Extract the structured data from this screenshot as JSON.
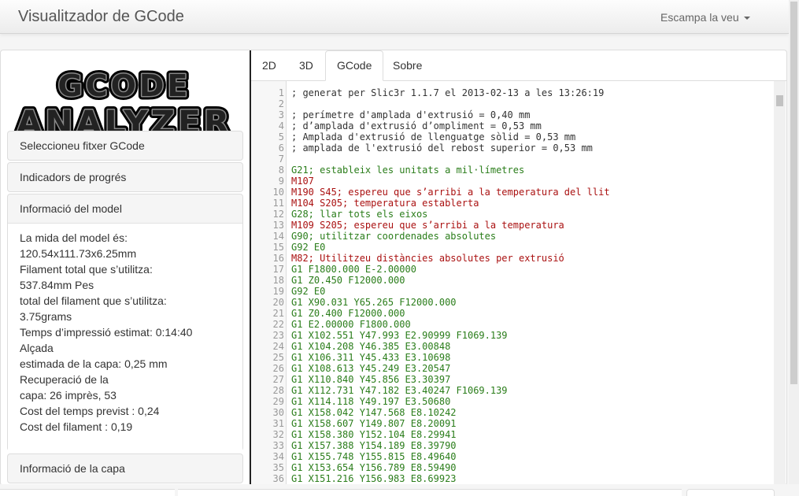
{
  "navbar": {
    "brand": "Visualitzador de GCode",
    "language_menu": "Escampa la veu"
  },
  "logo": {
    "line1": "GCODE",
    "line2": "ANALYZER"
  },
  "sidebar": {
    "sections": [
      {
        "title": "Seleccioneu fitxer GCode"
      },
      {
        "title": "Indicadors de progrés"
      },
      {
        "title": "Informació del model",
        "lines": [
          "La mida del model és:",
          "120.54x111.73x6.25mm",
          "Filament total que s’utilitza:",
          "537.84mm Pes",
          "total del filament que s’utilitza:",
          "3.75grams",
          "Temps d’impressió estimat: 0:14:40",
          "Alçada",
          "estimada de la capa: 0,25 mm",
          "Recuperació de la",
          "capa: 26 imprès, 53",
          "Cost del temps previst : 0,24",
          "Cost del filament : 0,19"
        ]
      },
      {
        "title": "Informació de la capa"
      }
    ]
  },
  "tabs": [
    {
      "label": "2D",
      "active": false
    },
    {
      "label": "3D",
      "active": false
    },
    {
      "label": "GCode",
      "active": true
    },
    {
      "label": "Sobre",
      "active": false
    }
  ],
  "editor": {
    "lines": [
      {
        "n": "1",
        "text": "; generat per Slic3r 1.1.7 el 2013-02-13 a les 13:26:19",
        "kind": "comment"
      },
      {
        "n": "2",
        "text": "",
        "kind": "comment"
      },
      {
        "n": "3",
        "text": "; perímetre d'amplada d'extrusió = 0,40 mm",
        "kind": "comment"
      },
      {
        "n": "4",
        "text": "; d’amplada d'extrusió d’ompliment = 0,53 mm",
        "kind": "comment"
      },
      {
        "n": "5",
        "text": "; Amplada d'extrusió de llenguatge sòlid = 0,53 mm",
        "kind": "comment"
      },
      {
        "n": "6",
        "text": "; amplada de l'extrusió del rebost superior = 0,53 mm",
        "kind": "comment"
      },
      {
        "n": "7",
        "text": "",
        "kind": "comment"
      },
      {
        "n": "8",
        "text": "G21; estableix les unitats a mil·límetres",
        "kind": "g"
      },
      {
        "n": "9",
        "text": "M107",
        "kind": "m"
      },
      {
        "n": "10",
        "text": "M190 S45; espereu que s’arribi a la temperatura del llit",
        "kind": "m"
      },
      {
        "n": "11",
        "text": "M104 S205; temperatura establerta",
        "kind": "m"
      },
      {
        "n": "12",
        "text": "G28; llar tots els eixos",
        "kind": "g"
      },
      {
        "n": "13",
        "text": "M109 S205; espereu que s’arribi a la temperatura",
        "kind": "m"
      },
      {
        "n": "14",
        "text": "G90; utilitzar coordenades absolutes",
        "kind": "g"
      },
      {
        "n": "15",
        "text": "G92 E0",
        "kind": "g"
      },
      {
        "n": "16",
        "text": "M82; Utilitzeu distàncies absolutes per extrusió",
        "kind": "m"
      },
      {
        "n": "17",
        "text": "G1 F1800.000 E-2.00000",
        "kind": "g"
      },
      {
        "n": "18",
        "text": "G1 Z0.450 F12000.000",
        "kind": "g"
      },
      {
        "n": "19",
        "text": "G92 E0",
        "kind": "g"
      },
      {
        "n": "20",
        "text": "G1 X90.031 Y65.265 F12000.000",
        "kind": "g"
      },
      {
        "n": "21",
        "text": "G1 Z0.400 F12000.000",
        "kind": "g"
      },
      {
        "n": "22",
        "text": "G1 E2.00000 F1800.000",
        "kind": "g"
      },
      {
        "n": "23",
        "text": "G1 X102.551 Y47.993 E2.90999 F1069.139",
        "kind": "g"
      },
      {
        "n": "24",
        "text": "G1 X104.208 Y46.385 E3.00848",
        "kind": "g"
      },
      {
        "n": "25",
        "text": "G1 X106.311 Y45.433 E3.10698",
        "kind": "g"
      },
      {
        "n": "26",
        "text": "G1 X108.613 Y45.249 E3.20547",
        "kind": "g"
      },
      {
        "n": "27",
        "text": "G1 X110.840 Y45.856 E3.30397",
        "kind": "g"
      },
      {
        "n": "28",
        "text": "G1 X112.731 Y47.182 E3.40247 F1069.139",
        "kind": "g"
      },
      {
        "n": "29",
        "text": "G1 X114.118 Y49.197 E3.50680",
        "kind": "g"
      },
      {
        "n": "30",
        "text": "G1 X158.042 Y147.568 E8.10242",
        "kind": "g"
      },
      {
        "n": "31",
        "text": "G1 X158.607 Y149.807 E8.20091",
        "kind": "g"
      },
      {
        "n": "32",
        "text": "G1 X158.380 Y152.104 E8.29941",
        "kind": "g"
      },
      {
        "n": "33",
        "text": "G1 X157.388 Y154.189 E8.39790",
        "kind": "g"
      },
      {
        "n": "34",
        "text": "G1 X155.748 Y155.815 E8.49640",
        "kind": "g"
      },
      {
        "n": "35",
        "text": "G1 X153.654 Y156.789 E8.59490",
        "kind": "g"
      },
      {
        "n": "36",
        "text": "G1 X151.216 Y156.983 E8.69923",
        "kind": "g"
      }
    ]
  }
}
